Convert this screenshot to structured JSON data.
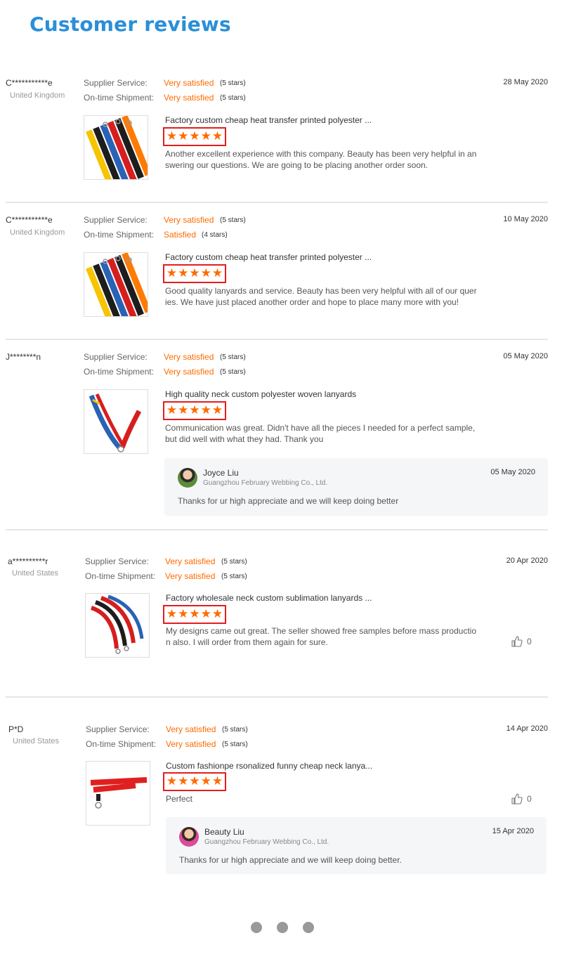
{
  "page_title": "Customer reviews",
  "labels": {
    "supplier_service": "Supplier Service:",
    "ontime_shipment": "On-time Shipment:"
  },
  "reviews": [
    {
      "buyer": "C***********e",
      "country": "United Kingdom",
      "date": "28 May 2020",
      "supplier_rating": "Very satisfied",
      "supplier_stars": "(5 stars)",
      "shipment_rating": "Very satisfied",
      "shipment_stars": "(5 stars)",
      "product_title": "Factory custom cheap heat transfer printed polyester ...",
      "product_stars": 5,
      "comment": "Another excellent experience with this company. Beauty has been very helpful in answering our questions. We are going to be placing another order soon."
    },
    {
      "buyer": "C***********e",
      "country": "United Kingdom",
      "date": "10 May 2020",
      "supplier_rating": "Very satisfied",
      "supplier_stars": "(5 stars)",
      "shipment_rating": "Satisfied",
      "shipment_stars": "(4 stars)",
      "product_title": "Factory custom cheap heat transfer printed polyester ...",
      "product_stars": 5,
      "comment": "Good quality lanyards and service. Beauty has been very helpful with all of our queries. We have just placed another order and hope to place many more with you!"
    },
    {
      "buyer": "J********n",
      "country": "",
      "date": "05 May 2020",
      "supplier_rating": "Very satisfied",
      "supplier_stars": "(5 stars)",
      "shipment_rating": "Very satisfied",
      "shipment_stars": "(5 stars)",
      "product_title": "High quality neck custom polyester woven lanyards",
      "product_stars": 5,
      "comment": "Communication was great. Didn't have all the pieces I needed for a perfect sample, but did well with what they had. Thank you",
      "reply": {
        "name": "Joyce Liu",
        "company": "Guangzhou February Webbing Co., Ltd.",
        "date": "05 May 2020",
        "text": "Thanks for ur high appreciate and we will keep doing better"
      }
    },
    {
      "buyer": "a**********r",
      "country": "United States",
      "date": "20 Apr 2020",
      "supplier_rating": "Very satisfied",
      "supplier_stars": "(5 stars)",
      "shipment_rating": "Very satisfied",
      "shipment_stars": "(5 stars)",
      "product_title": "Factory wholesale neck custom sublimation lanyards ...",
      "product_stars": 5,
      "comment": "My designs came out great. The seller showed free samples before mass production also. I will order from them again for sure.",
      "likes": "0"
    },
    {
      "buyer": "P*D",
      "country": "United States",
      "date": "14 Apr 2020",
      "supplier_rating": "Very satisfied",
      "supplier_stars": "(5 stars)",
      "shipment_rating": "Very satisfied",
      "shipment_stars": "(5 stars)",
      "product_title": "Custom fashionpe rsonalized funny cheap neck lanya...",
      "product_stars": 5,
      "comment": "Perfect",
      "likes": "0",
      "reply": {
        "name": "Beauty Liu",
        "company": "Guangzhou February Webbing Co., Ltd.",
        "date": "15 Apr 2020",
        "text": "Thanks for ur high appreciate and we will keep doing better."
      }
    }
  ],
  "pagination": {
    "pages": 3
  },
  "colors": {
    "title": "#2a8fd8",
    "rating": "#ff6a00",
    "star_border": "#e21e1e"
  },
  "icons": {
    "like": "thumbs-up-icon"
  }
}
